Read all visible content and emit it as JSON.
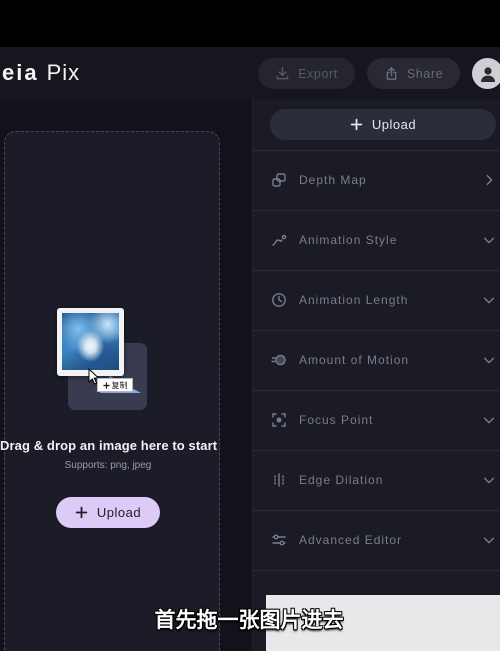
{
  "app": {
    "logo": {
      "part1": "eia",
      "part2": "Pix"
    }
  },
  "header": {
    "export": {
      "label": "Export",
      "icon": "download-icon"
    },
    "share": {
      "label": "Share",
      "icon": "share-icon"
    },
    "avatar": {
      "icon": "user-icon"
    }
  },
  "dropzone": {
    "title": "Drag & drop an image here to start",
    "supports": "Supports: png, jpeg",
    "upload_button": {
      "label": "Upload",
      "icon": "plus-icon"
    },
    "drag_preview": {
      "tooltip_label": "复制",
      "tooltip_icon": "plus-icon",
      "cursor_icon": "cursor-arrow-icon",
      "placeholder_icon": "image-placeholder-icon"
    }
  },
  "panel": {
    "upload_button": {
      "label": "Upload",
      "icon": "plus-icon"
    },
    "sections": [
      {
        "label": "Depth Map",
        "icon": "layers-icon",
        "chevron": "chevron-right-icon"
      },
      {
        "label": "Animation Style",
        "icon": "curve-icon",
        "chevron": "chevron-down-icon"
      },
      {
        "label": "Animation Length",
        "icon": "clock-icon",
        "chevron": "chevron-down-icon"
      },
      {
        "label": "Amount of Motion",
        "icon": "motion-icon",
        "chevron": "chevron-down-icon"
      },
      {
        "label": "Focus Point",
        "icon": "focus-point-icon",
        "chevron": "chevron-down-icon"
      },
      {
        "label": "Edge Dilation",
        "icon": "edge-dilation-icon",
        "chevron": "chevron-down-icon"
      },
      {
        "label": "Advanced Editor",
        "icon": "sliders-icon",
        "chevron": "chevron-down-icon"
      }
    ]
  },
  "subtitle": "首先拖一张图片进去",
  "colors": {
    "background": "#12131a",
    "panel": "#1a1b25",
    "accent": "#dccbf6",
    "text": "#f2f2f5",
    "muted_text": "#7b7c8d"
  }
}
